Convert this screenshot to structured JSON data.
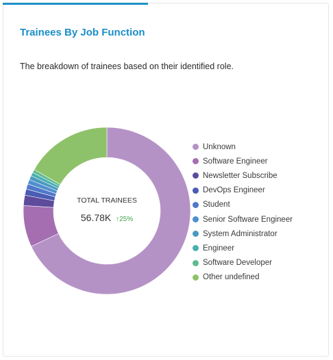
{
  "card": {
    "title": "Trainees By Job Function",
    "subtitle": "The breakdown of trainees based on their identified role."
  },
  "summary": {
    "label": "TOTAL TRAINEES",
    "value": "56.78K",
    "delta": "25%",
    "delta_color": "#3fa54a"
  },
  "chart_data": {
    "type": "pie",
    "donut": true,
    "categories": [
      "Unknown",
      "Software Engineer",
      "Newsletter Subscribe",
      "DevOps Engineer",
      "Student",
      "Senior Software Engineer",
      "System Administrator",
      "Engineer",
      "Software Developer",
      "Other undefined"
    ],
    "values": [
      68.0,
      8.0,
      2.0,
      1.2,
      1.0,
      0.9,
      0.8,
      0.7,
      0.6,
      16.8
    ],
    "colors": [
      "#b592c6",
      "#a46eb1",
      "#5e4b9c",
      "#4b5cb3",
      "#4f79c9",
      "#4f8fcf",
      "#4a9ac0",
      "#4bafb2",
      "#5fba8f",
      "#8ec26a"
    ],
    "legend_position": "right"
  }
}
